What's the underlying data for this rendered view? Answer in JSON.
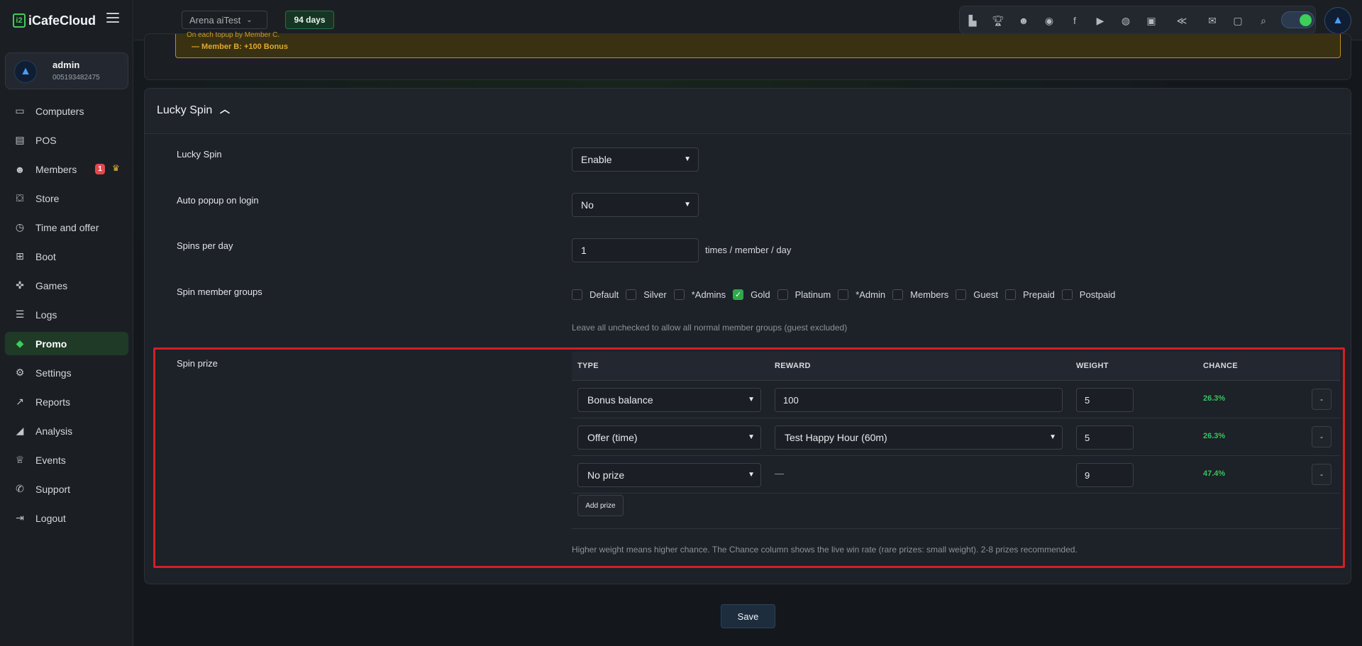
{
  "app": {
    "logo_text": "iCafeCloud",
    "logo_mark": "i2"
  },
  "profile": {
    "name": "admin",
    "id": "005193482475"
  },
  "sidebar": {
    "items": [
      {
        "label": "Computers",
        "icon": "monitor-icon"
      },
      {
        "label": "POS",
        "icon": "register-icon"
      },
      {
        "label": "Members",
        "icon": "users-icon",
        "badge": "1"
      },
      {
        "label": "Store",
        "icon": "bag-icon"
      },
      {
        "label": "Time and offer",
        "icon": "stopwatch-icon"
      },
      {
        "label": "Boot",
        "icon": "windows-icon"
      },
      {
        "label": "Games",
        "icon": "gamepad-icon"
      },
      {
        "label": "Logs",
        "icon": "list-icon"
      },
      {
        "label": "Promo",
        "icon": "tag-icon",
        "active": true
      },
      {
        "label": "Settings",
        "icon": "gear-icon"
      },
      {
        "label": "Reports",
        "icon": "chart-line-icon"
      },
      {
        "label": "Analysis",
        "icon": "area-chart-icon"
      },
      {
        "label": "Events",
        "icon": "crown-icon"
      },
      {
        "label": "Support",
        "icon": "phone-icon"
      },
      {
        "label": "Logout",
        "icon": "logout-icon"
      }
    ]
  },
  "topbar": {
    "cafe": "Arena aiTest",
    "days": "94 days"
  },
  "prev": {
    "line1": "On each topup by Member C.",
    "line2": "— Member B: +100 Bonus"
  },
  "lucky": {
    "title": "Lucky Spin",
    "fields": {
      "lucky_spin_label": "Lucky Spin",
      "lucky_spin_value": "Enable",
      "auto_popup_label": "Auto popup on login",
      "auto_popup_value": "No",
      "spins_label": "Spins per day",
      "spins_value": "1",
      "spins_suffix": "times / member / day",
      "groups_label": "Spin member groups",
      "groups_hint": "Leave all unchecked to allow all normal member groups (guest excluded)",
      "prize_label": "Spin prize"
    },
    "groups": [
      {
        "label": "Default",
        "checked": false
      },
      {
        "label": "Silver",
        "checked": false
      },
      {
        "label": "*Admins",
        "checked": false
      },
      {
        "label": "Gold",
        "checked": true
      },
      {
        "label": "Platinum",
        "checked": false
      },
      {
        "label": "*Admin",
        "checked": false
      },
      {
        "label": "Members",
        "checked": false
      },
      {
        "label": "Guest",
        "checked": false
      },
      {
        "label": "Prepaid",
        "checked": false
      },
      {
        "label": "Postpaid",
        "checked": false
      }
    ],
    "table": {
      "headers": {
        "type": "TYPE",
        "reward": "REWARD",
        "weight": "WEIGHT",
        "chance": "CHANCE"
      },
      "rows": [
        {
          "type": "Bonus balance",
          "reward": "100",
          "reward_kind": "input",
          "weight": "5",
          "chance": "26.3%",
          "remove": "-"
        },
        {
          "type": "Offer (time)",
          "reward": "Test Happy Hour (60m)",
          "reward_kind": "select",
          "weight": "5",
          "chance": "26.3%",
          "remove": "-"
        },
        {
          "type": "No prize",
          "reward": "—",
          "reward_kind": "none",
          "weight": "9",
          "chance": "47.4%",
          "remove": "-"
        }
      ],
      "add_label": "Add prize",
      "footnote": "Higher weight means higher chance. The Chance column shows the live win rate (rare prizes: small weight). 2-8 prizes recommended."
    },
    "save_label": "Save"
  },
  "colors": {
    "accent": "#3ccf5a",
    "highlight": "#d21f26",
    "chance": "#34c759"
  }
}
